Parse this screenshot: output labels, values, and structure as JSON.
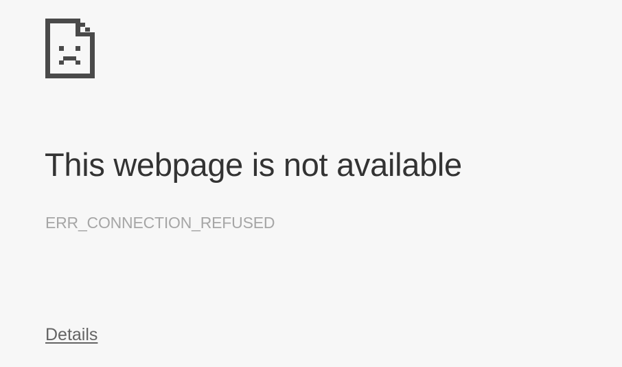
{
  "error_page": {
    "icon": "sad-page-icon",
    "title": "This webpage is not available",
    "error_code": "ERR_CONNECTION_REFUSED",
    "details_label": "Details"
  },
  "colors": {
    "background": "#f7f7f7",
    "title": "#333333",
    "error_code": "#a6a6a6",
    "link": "#646464",
    "icon": "#4a4a4a"
  }
}
